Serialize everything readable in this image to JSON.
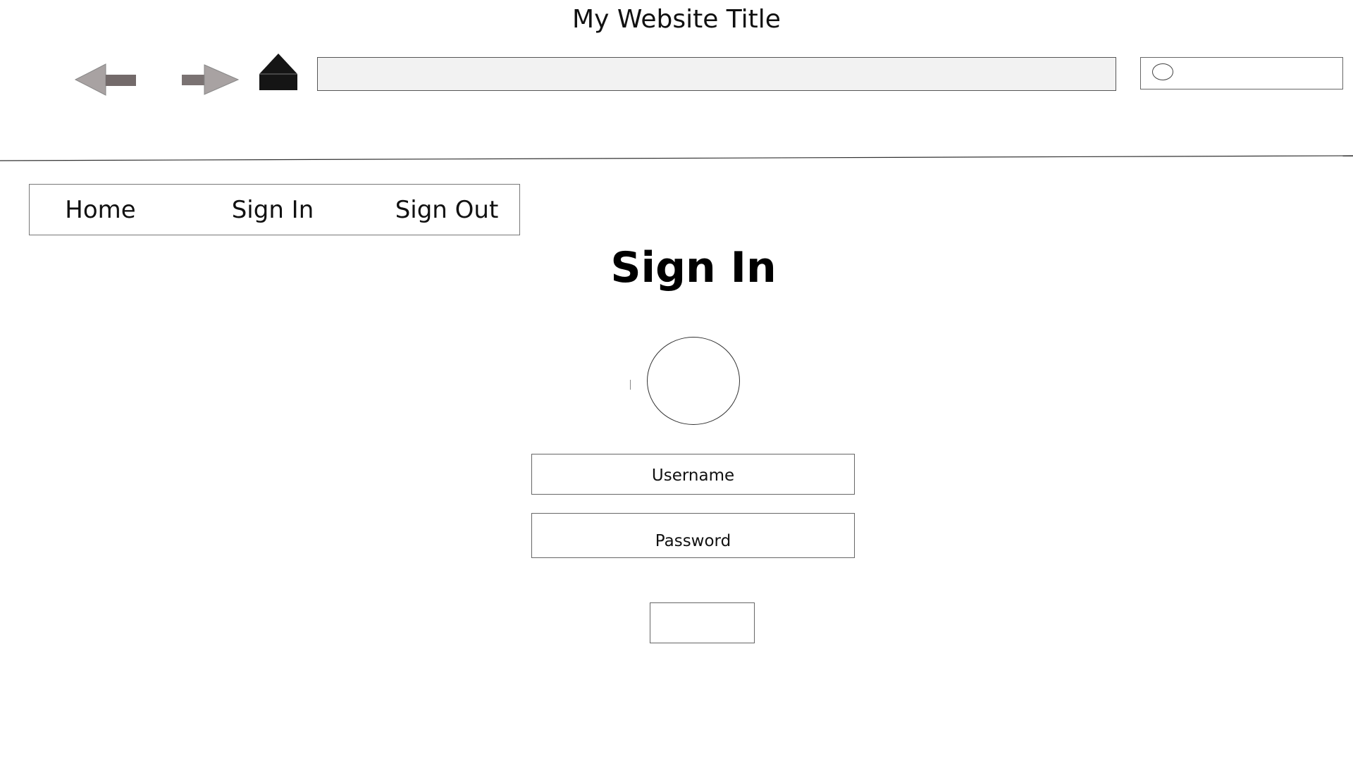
{
  "site": {
    "title": "My Website Title"
  },
  "browser": {
    "icons": {
      "back": "back-arrow-icon",
      "forward": "forward-arrow-icon",
      "home": "home-icon",
      "search": "search-icon"
    },
    "address_value": "",
    "search_value": ""
  },
  "nav": {
    "items": [
      {
        "label": "Home"
      },
      {
        "label": "Sign In"
      },
      {
        "label": "Sign Out"
      }
    ]
  },
  "main": {
    "heading": "Sign In",
    "avatar_icon": "user-avatar-icon",
    "username_placeholder": "Username",
    "password_placeholder": "Password",
    "submit_label": ""
  },
  "colors": {
    "arrow_light": "#a8a2a2",
    "arrow_dark": "#736a6a",
    "home_icon": "#151515",
    "address_bg": "#f2f2f2"
  }
}
